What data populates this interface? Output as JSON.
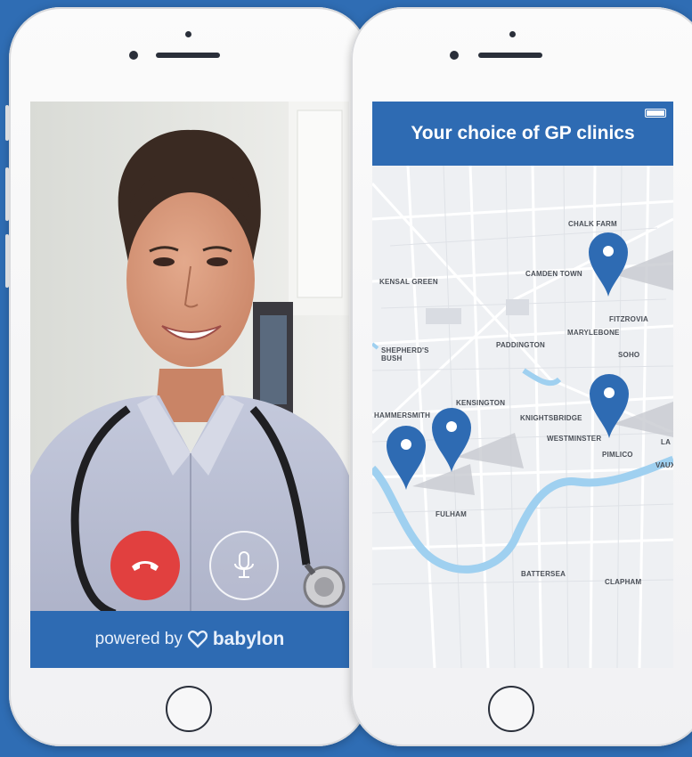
{
  "video_call": {
    "footer": {
      "powered_by": "powered by",
      "brand": "babylon"
    },
    "controls": {
      "end_call_icon": "phone-hangup-icon",
      "mute_icon": "microphone-icon"
    }
  },
  "map_screen": {
    "header_title": "Your choice of GP clinics",
    "pin_icon": "map-pin-icon",
    "colors": {
      "accent": "#2e6bb3",
      "end_call": "#e1403f",
      "river": "#9fd0f0"
    },
    "places": [
      {
        "name": "CHALK FARM"
      },
      {
        "name": "CAMDEN TOWN"
      },
      {
        "name": "KENSAL GREEN"
      },
      {
        "name": "FITZROVIA"
      },
      {
        "name": "MARYLEBONE"
      },
      {
        "name": "PADDINGTON"
      },
      {
        "name": "SHEPHERD'S\nBUSH"
      },
      {
        "name": "SOHO"
      },
      {
        "name": "KENSINGTON"
      },
      {
        "name": "HAMMERSMITH"
      },
      {
        "name": "KNIGHTSBRIDGE"
      },
      {
        "name": "WESTMINSTER"
      },
      {
        "name": "PIMLICO"
      },
      {
        "name": "LA"
      },
      {
        "name": "VAUX"
      },
      {
        "name": "FULHAM"
      },
      {
        "name": "BATTERSEA"
      },
      {
        "name": "CLAPHAM"
      }
    ]
  }
}
